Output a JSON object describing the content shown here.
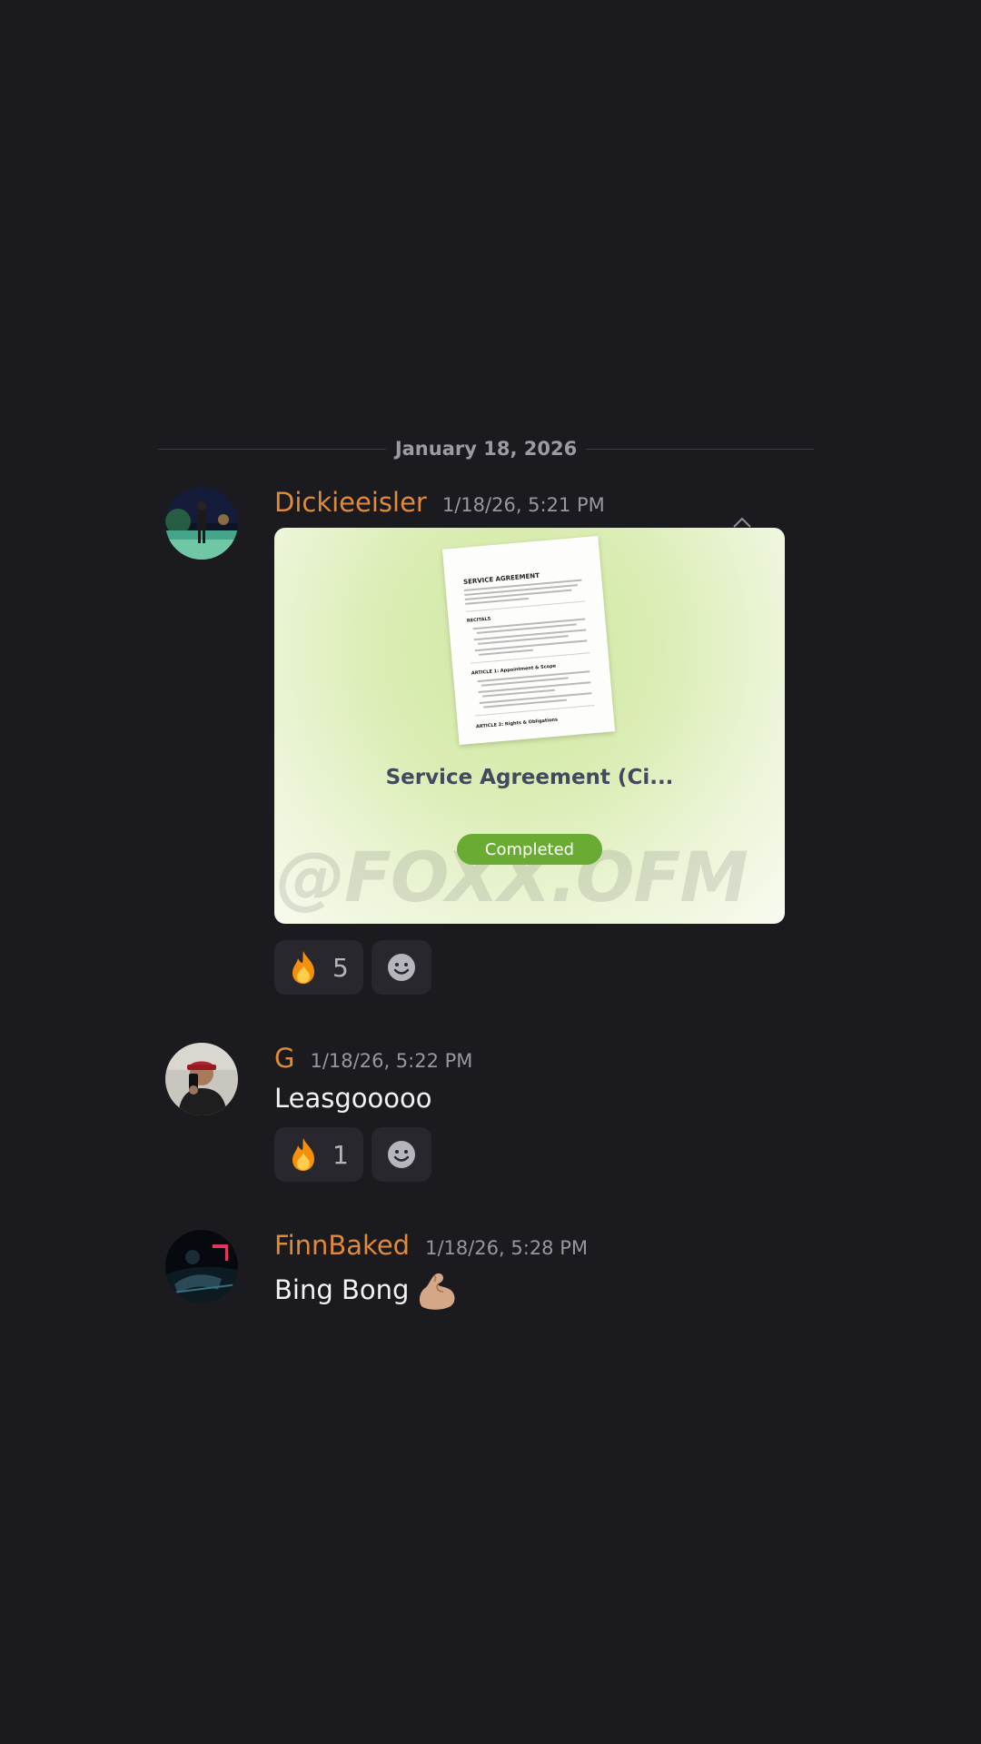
{
  "date_divider": "January 18, 2026",
  "colors": {
    "background": "#1b1a1f",
    "username": "#e08a3b",
    "timestamp": "#97989f",
    "reaction_bg": "#27272d",
    "badge_green": "#6aab33"
  },
  "messages": [
    {
      "username": "Dickieeisler",
      "timestamp": "1/18/26, 5:21 PM",
      "avatar_icon": "avatar-photo-pool-night",
      "attachment": {
        "title": "Service Agreement (Ci...",
        "status": "Completed",
        "watermark": "@FOXX.OFM",
        "document": {
          "heading": "SERVICE AGREEMENT",
          "section1": "RECITALS",
          "section2": "ARTICLE 1: Appointment & Scope",
          "section3": "ARTICLE 2: Rights & Obligations"
        }
      },
      "reactions": [
        {
          "emoji": "🔥",
          "icon": "fire-icon",
          "count": "5"
        }
      ],
      "add_reaction_icon": "add-reaction-smiley-icon"
    },
    {
      "username": "G",
      "timestamp": "1/18/26, 5:22 PM",
      "avatar_icon": "avatar-photo-mirror-selfie",
      "text": "Leasgooooo",
      "reactions": [
        {
          "emoji": "🔥",
          "icon": "fire-icon",
          "count": "1"
        }
      ],
      "add_reaction_icon": "add-reaction-smiley-icon"
    },
    {
      "username": "FinnBaked",
      "timestamp": "1/18/26, 5:28 PM",
      "avatar_icon": "avatar-photo-car-interior",
      "text": "Bing Bong",
      "text_emoji": "💪🏼"
    }
  ]
}
